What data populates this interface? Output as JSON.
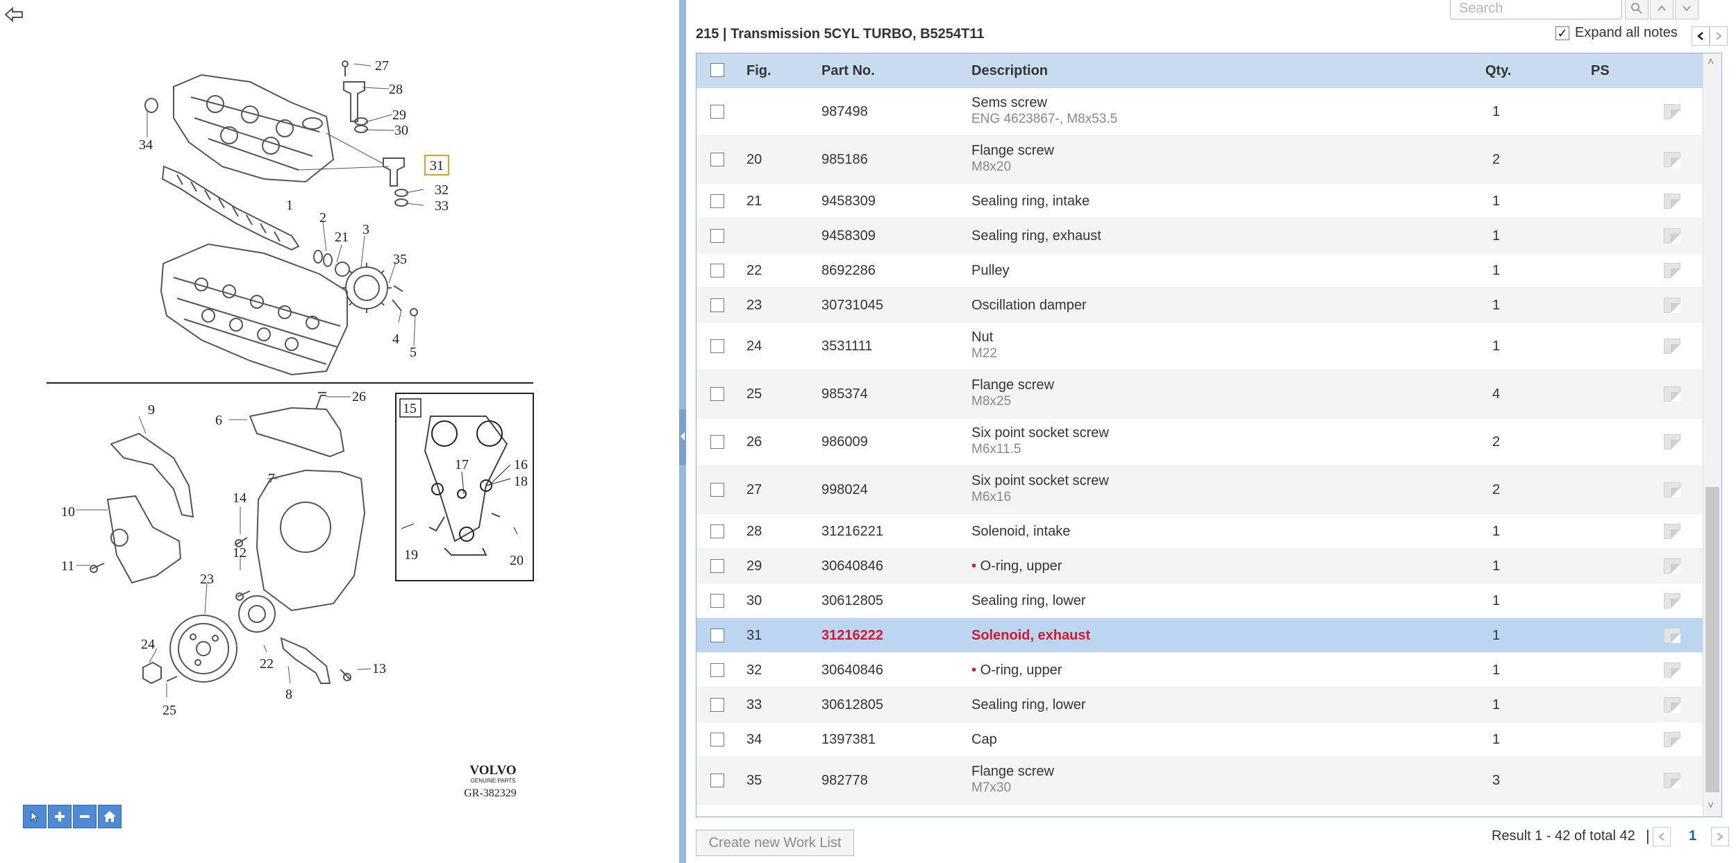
{
  "diagram": {
    "callouts": {
      "c27": "27",
      "c28": "28",
      "c29": "29",
      "c30": "30",
      "c31": "31",
      "c32": "32",
      "c33": "33",
      "c34": "34",
      "c1": "1",
      "c2": "2",
      "c21": "21",
      "c3": "3",
      "c35": "35",
      "c4": "4",
      "c5": "5",
      "c26": "26",
      "c9": "9",
      "c6": "6",
      "c7": "7",
      "c10": "10",
      "c11": "11",
      "c14": "14",
      "c12": "12",
      "c23": "23",
      "c24": "24",
      "c25": "25",
      "c22": "22",
      "c8": "8",
      "c13": "13",
      "c15": "15",
      "c16": "16",
      "c17": "17",
      "c18": "18",
      "c19": "19",
      "c20": "20"
    },
    "brand": "VOLVO",
    "brand_sub": "GENUINE PARTS",
    "ref": "GR-382329"
  },
  "search": {
    "placeholder": "Search"
  },
  "section_title": "215  |  Transmission 5CYL TURBO, B5254T11",
  "expand_notes_label": "Expand all notes",
  "table": {
    "headers": {
      "fig": "Fig.",
      "part": "Part No.",
      "desc": "Description",
      "qty": "Qty.",
      "ps": "PS"
    },
    "rows": [
      {
        "fig": "",
        "part": "987498",
        "desc": "Sems screw",
        "sub": "ENG 4623867-, M8x53.5",
        "qty": "1",
        "bullet": false,
        "selected": false
      },
      {
        "fig": "20",
        "part": "985186",
        "desc": "Flange screw",
        "sub": "M8x20",
        "qty": "2",
        "bullet": false,
        "selected": false
      },
      {
        "fig": "21",
        "part": "9458309",
        "desc": "Sealing ring, intake",
        "sub": "",
        "qty": "1",
        "bullet": false,
        "selected": false
      },
      {
        "fig": "",
        "part": "9458309",
        "desc": "Sealing ring, exhaust",
        "sub": "",
        "qty": "1",
        "bullet": false,
        "selected": false
      },
      {
        "fig": "22",
        "part": "8692286",
        "desc": "Pulley",
        "sub": "",
        "qty": "1",
        "bullet": false,
        "selected": false
      },
      {
        "fig": "23",
        "part": "30731045",
        "desc": "Oscillation damper",
        "sub": "",
        "qty": "1",
        "bullet": false,
        "selected": false
      },
      {
        "fig": "24",
        "part": "3531111",
        "desc": "Nut",
        "sub": "M22",
        "qty": "1",
        "bullet": false,
        "selected": false
      },
      {
        "fig": "25",
        "part": "985374",
        "desc": "Flange screw",
        "sub": "M8x25",
        "qty": "4",
        "bullet": false,
        "selected": false
      },
      {
        "fig": "26",
        "part": "986009",
        "desc": "Six point socket screw",
        "sub": "M6x11.5",
        "qty": "2",
        "bullet": false,
        "selected": false
      },
      {
        "fig": "27",
        "part": "998024",
        "desc": "Six point socket screw",
        "sub": "M6x16",
        "qty": "2",
        "bullet": false,
        "selected": false
      },
      {
        "fig": "28",
        "part": "31216221",
        "desc": "Solenoid, intake",
        "sub": "",
        "qty": "1",
        "bullet": false,
        "selected": false
      },
      {
        "fig": "29",
        "part": "30640846",
        "desc": "O-ring, upper",
        "sub": "",
        "qty": "1",
        "bullet": true,
        "selected": false
      },
      {
        "fig": "30",
        "part": "30612805",
        "desc": "Sealing ring, lower",
        "sub": "",
        "qty": "1",
        "bullet": false,
        "selected": false
      },
      {
        "fig": "31",
        "part": "31216222",
        "desc": "Solenoid, exhaust",
        "sub": "",
        "qty": "1",
        "bullet": false,
        "selected": true
      },
      {
        "fig": "32",
        "part": "30640846",
        "desc": "O-ring, upper",
        "sub": "",
        "qty": "1",
        "bullet": true,
        "selected": false
      },
      {
        "fig": "33",
        "part": "30612805",
        "desc": "Sealing ring, lower",
        "sub": "",
        "qty": "1",
        "bullet": false,
        "selected": false
      },
      {
        "fig": "34",
        "part": "1397381",
        "desc": "Cap",
        "sub": "",
        "qty": "1",
        "bullet": false,
        "selected": false
      },
      {
        "fig": "35",
        "part": "982778",
        "desc": "Flange screw",
        "sub": "M7x30",
        "qty": "3",
        "bullet": false,
        "selected": false
      }
    ]
  },
  "footer": {
    "work_list_label": "Create new Work List",
    "result_text": "Result 1 - 42 of total 42",
    "separator": "|",
    "page": "1"
  },
  "colors": {
    "header_bg": "#c9dcef",
    "selected_bg": "#bcd6f2",
    "accent_red": "#d0192c",
    "toolbar_blue": "#4f8ad6"
  }
}
